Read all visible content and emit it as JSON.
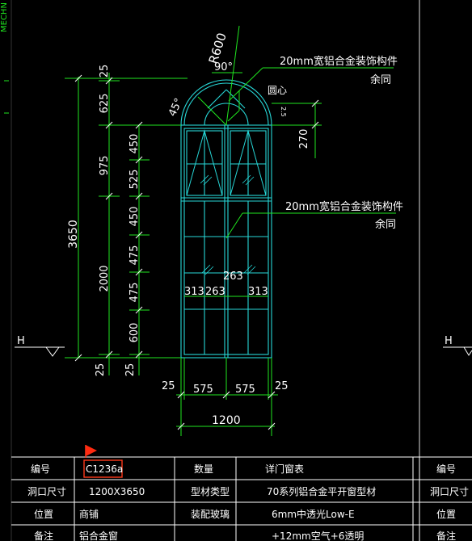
{
  "left_ruler": {
    "label": "MECHN"
  },
  "drawing": {
    "overall_height": "3650",
    "dims_left_outer": [
      "25",
      "625",
      "975",
      "2000",
      "25"
    ],
    "dims_left_inner": [
      "450",
      "525",
      "450",
      "475",
      "475",
      "600",
      "25"
    ],
    "arch_right_dim": "270",
    "radius": "R600",
    "angle_90": "90°",
    "angle_45": "45°",
    "center_note": "圆心",
    "mullion_center": "263",
    "mullion_row": [
      "313",
      "263",
      "313"
    ],
    "bottom_side_dims": [
      "25",
      "25"
    ],
    "bottom_halves": [
      "575",
      "575"
    ],
    "bottom_total": "1200",
    "level_marker": "H",
    "note_top_line1": "20mm宽铝合金装饰构件",
    "note_top_line2": "余同",
    "note_mid_line1": "20mm宽铝合金装饰构件",
    "note_mid_line2": "余同"
  },
  "title_block": {
    "rows": [
      {
        "label": "编号",
        "value": "C1236a",
        "label2": "数量",
        "value2": "详门窗表",
        "label3": "编号"
      },
      {
        "label": "洞口尺寸",
        "value": "1200X3650",
        "label2": "型材类型",
        "value2": "70系列铝合金平开窗型材",
        "label3": "洞口尺寸"
      },
      {
        "label": "位置",
        "value": "商铺",
        "label2": "装配玻璃",
        "value2": "6mm中透光Low-E",
        "label3": "位置"
      },
      {
        "label": "备注",
        "value": "铝合金窗",
        "label2": "",
        "value2": "+12mm空气+6透明",
        "label3": "备注"
      }
    ]
  }
}
